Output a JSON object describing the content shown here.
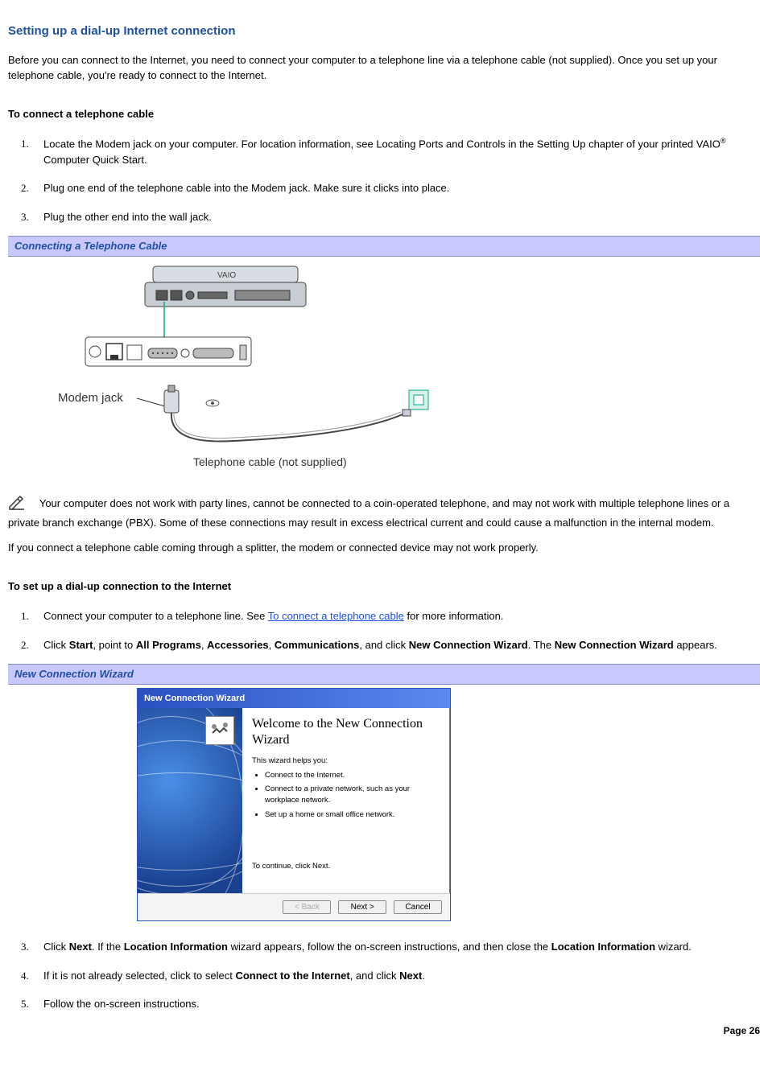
{
  "heading": "Setting up a dial-up Internet connection",
  "intro": "Before you can connect to the Internet, you need to connect your computer to a telephone line via a telephone cable (not supplied). Once you set up your telephone cable, you're ready to connect to the Internet.",
  "section1_title": "To connect a telephone cable",
  "section1_steps": [
    {
      "n": "1.",
      "pre": "Locate the Modem jack on your computer. For location information, see Locating Ports and Controls in the Setting Up chapter of your printed VAIO",
      "post": " Computer Quick Start."
    },
    {
      "n": "2.",
      "text": "Plug one end of the telephone cable into the Modem jack. Make sure it clicks into place."
    },
    {
      "n": "3.",
      "text": "Plug the other end into the wall jack."
    }
  ],
  "figure1_caption": "Connecting a Telephone Cable",
  "illustration": {
    "modem_label": "Modem jack",
    "cable_label": "Telephone cable (not supplied)"
  },
  "note1_intro": "Your computer does not work with party lines, cannot be connected to a coin-operated telephone, and may not work with multiple telephone lines or a private branch exchange (PBX). Some of these connections may result in excess electrical current and could cause a malfunction in the internal modem.",
  "note2": "If you connect a telephone cable coming through a splitter, the modem or connected device may not work properly.",
  "section2_title": "To set up a dial-up connection to the Internet",
  "section2_steps": [
    {
      "n": "1.",
      "pre": "Connect your computer to a telephone line. See ",
      "link": "To connect a telephone cable",
      "post": " for more information."
    },
    {
      "n": "2.",
      "pre": "Click ",
      "b1": "Start",
      "mid1": ", point to ",
      "b2": "All Programs",
      "mid2": ", ",
      "b3": "Accessories",
      "mid3": ", ",
      "b4": "Communications",
      "mid4": ", and click ",
      "b5": "New Connection Wizard",
      "mid5": ". The ",
      "b6": "New Connection Wizard",
      "post": " appears."
    },
    {
      "n": "3.",
      "pre": "Click ",
      "b1": "Next",
      "mid1": ". If the ",
      "b2": "Location Information",
      "mid2": " wizard appears, follow the on-screen instructions, and then close the ",
      "b3": "Location Information",
      "post": " wizard."
    },
    {
      "n": "4.",
      "pre": "If it is not already selected, click to select ",
      "b1": "Connect to the Internet",
      "mid1": ", and click ",
      "b2": "Next",
      "post": "."
    },
    {
      "n": "5.",
      "text": "Follow the on-screen instructions."
    }
  ],
  "figure2_caption": "New Connection Wizard",
  "wizard": {
    "title": "New Connection Wizard",
    "welcome": "Welcome to the New Connection Wizard",
    "help": "This wizard helps you:",
    "bullets": [
      "Connect to the Internet.",
      "Connect to a private network, such as your workplace network.",
      "Set up a home or small office network."
    ],
    "continue": "To continue, click Next.",
    "back": "< Back",
    "next": "Next >",
    "cancel": "Cancel"
  },
  "page_footer": "Page 26"
}
